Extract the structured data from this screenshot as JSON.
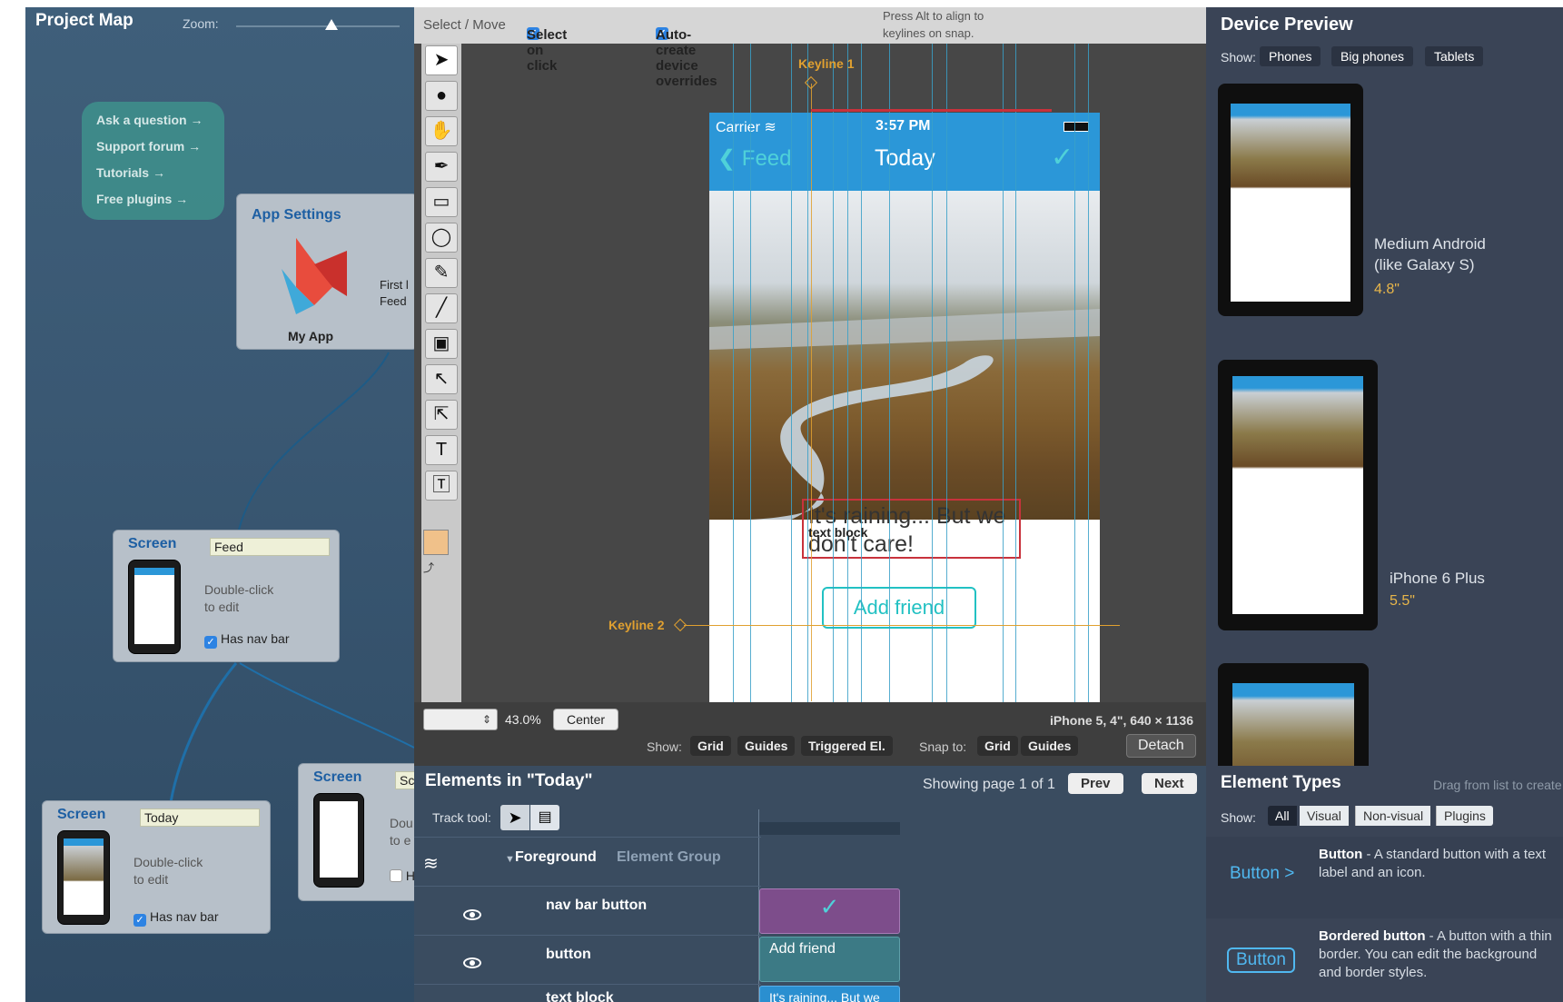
{
  "project_map": {
    "title": "Project Map",
    "zoom_label": "Zoom:",
    "help_links": [
      "Ask a question →",
      "Support forum →",
      "Tutorials →",
      "Free plugins →"
    ],
    "app_settings": {
      "title": "App Settings",
      "app_name": "My App",
      "side_text_1": "First l",
      "side_text_2": "Feed"
    },
    "screen_feed": {
      "title": "Screen",
      "name_value": "Feed",
      "hint_1": "Double-click",
      "hint_2": "to edit",
      "checkbox": "Has nav bar"
    },
    "screen_today": {
      "title": "Screen",
      "name_value": "Today",
      "hint_1": "Double-click",
      "hint_2": "to edit",
      "checkbox": "Has nav bar"
    },
    "screen_third": {
      "title": "Screen",
      "name_value": "Sc",
      "hint_1": "Dou",
      "hint_2": "to e",
      "checkbox": "H"
    }
  },
  "toolbar": {
    "mode": "Select / Move",
    "select_on_click": "Select on click",
    "auto_overrides": "Auto-create device overrides",
    "hint_1": "Press Alt to align to",
    "hint_2": "keylines on snap."
  },
  "canvas": {
    "keyline1": "Keyline 1",
    "keyline2": "Keyline 2",
    "text_block_label": "text block",
    "phone": {
      "carrier": "Carrier",
      "time": "3:57 PM",
      "back": "Feed",
      "title": "Today",
      "body_1": "It's raining... But we",
      "body_2": "don't care!",
      "button": "Add friend"
    }
  },
  "canvas_bar": {
    "zoom_percent": "43.0%",
    "center": "Center",
    "device_info": "iPhone 5, 4\", 640 × 1136",
    "show_label": "Show:",
    "show_grid": "Grid",
    "show_guides": "Guides",
    "show_triggered": "Triggered El.",
    "snap_label": "Snap to:",
    "snap_grid": "Grid",
    "snap_guides": "Guides",
    "detach": "Detach"
  },
  "device_preview": {
    "title": "Device Preview",
    "show_label": "Show:",
    "filters": [
      "Phones",
      "Big phones",
      "Tablets"
    ],
    "devices": [
      {
        "name_1": "Medium Android",
        "name_2": "(like Galaxy S)",
        "size": "4.8\""
      },
      {
        "name_1": "iPhone 6 Plus",
        "name_2": "",
        "size": "5.5\""
      }
    ]
  },
  "elements": {
    "title": "Elements in \"Today\"",
    "paging": "Showing page 1 of 1",
    "prev": "Prev",
    "next": "Next",
    "track_tool": "Track tool:",
    "group_name": "Foreground",
    "group_type": "Element Group",
    "rows": [
      {
        "label": "nav bar button",
        "track": "✓"
      },
      {
        "label": "button",
        "track": "Add friend"
      },
      {
        "label": "text block",
        "track": "It's raining... But we"
      }
    ]
  },
  "element_types": {
    "title": "Element Types",
    "hint": "Drag from list to create",
    "show_label": "Show:",
    "filters": [
      "All",
      "Visual",
      "Non-visual",
      "Plugins"
    ],
    "items": [
      {
        "sample": "Button >",
        "name": "Button",
        "desc": " - A standard button with a text label and an icon."
      },
      {
        "sample": "Button",
        "name": "Bordered button",
        "desc": " - A button with a thin border. You can edit the background and border styles."
      }
    ]
  },
  "colors": {
    "nav_blue": "#2b97d8",
    "accent_cyan": "#22c1c3",
    "keyline_orange": "#e0a030",
    "selection_red": "#c8323c"
  }
}
